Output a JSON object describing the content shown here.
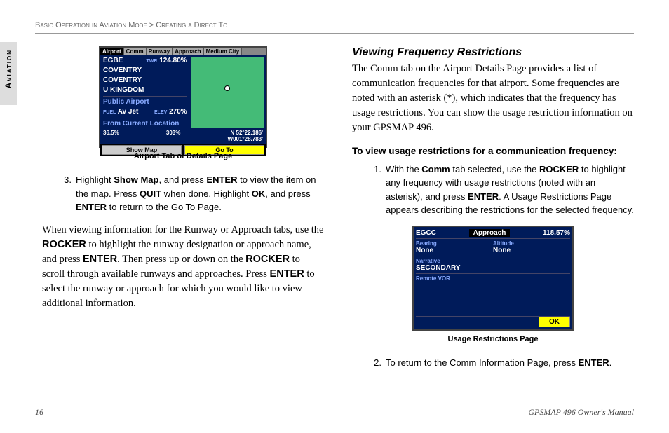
{
  "breadcrumb": {
    "section": "Basic Operation in Aviation Mode",
    "sep": " > ",
    "sub": "Creating a Direct To"
  },
  "tab": "Aviation",
  "sc1": {
    "tabs": [
      "Airport",
      "Comm",
      "Runway",
      "Approach",
      "Medium City"
    ],
    "row_airport": "EGBE",
    "row_airport_twr": "TWR",
    "row_airport_freq": "124.80%",
    "city1": "COVENTRY",
    "city2": "COVENTRY",
    "country": "U KINGDOM",
    "sec2_title": "Public Airport",
    "fuel_lbl": "FUEL",
    "fuel_val": "Av Jet",
    "elev_lbl": "ELEV",
    "elev_val": "270%",
    "sec3_title": "From Current Location",
    "dist": "36.5%",
    "brg": "303%",
    "lat": "N 52°22.186'",
    "lon": "W001°28.783'",
    "btn1": "Show Map",
    "btn2": "Go To"
  },
  "caption1": "Airport Tab of Details Page",
  "step3_n": "3.",
  "step3_a": "Highlight ",
  "step3_b": "Show Map",
  "step3_c": ", and press ",
  "step3_d": "ENTER",
  "step3_e": " to view the item on the map. Press ",
  "step3_f": "QUIT",
  "step3_g": " when done. Highlight ",
  "step3_h": "OK",
  "step3_i": ", and press ",
  "step3_j": "ENTER",
  "step3_k": " to return to the Go To Page.",
  "para1_a": "When viewing information for the Runway or Approach tabs, use the ",
  "para1_b": "ROCKER",
  "para1_c": " to highlight the runway designation or approach name, and press ",
  "para1_d": "ENTER",
  "para1_e": ". Then press up or down on the ",
  "para1_f": "ROCKER",
  "para1_g": " to scroll through available runways and approaches. Press ",
  "para1_h": "ENTER",
  "para1_i": " to select the runway or approach for which you would like to view additional information.",
  "h3": "Viewing Frequency Restrictions",
  "para2": "The Comm tab on the Airport Details Page provides a list of communication frequencies for that airport. Some frequencies are noted with an asterisk (*), which indicates that the frequency has usage restrictions. You can show the usage restriction information on your GPSMAP 496.",
  "h4": "To view usage restrictions for a communication frequency:",
  "s1_n": "1.",
  "s1_a": "With the ",
  "s1_b": "Comm",
  "s1_c": " tab selected, use the ",
  "s1_d": "ROCKER",
  "s1_e": " to highlight any frequency with usage restrictions (noted with an asterisk), and press ",
  "s1_f": "ENTER",
  "s1_g": ". A Usage Restrictions Page appears describing the restrictions for the selected frequency.",
  "sc2": {
    "icao": "EGCC",
    "type": "Approach",
    "freq": "118.57%",
    "bearing_lbl": "Bearing",
    "bearing_val": "None",
    "alt_lbl": "Altitude",
    "alt_val": "None",
    "narr_lbl": "Narrative",
    "narr_val": "SECONDARY",
    "vor_lbl": "Remote VOR",
    "ok": "OK"
  },
  "caption2": "Usage Restrictions Page",
  "s2_n": "2.",
  "s2_a": "To return to the Comm Information Page, press ",
  "s2_b": "ENTER",
  "s2_c": ".",
  "page": "16",
  "manual": "GPSMAP 496 Owner's Manual"
}
